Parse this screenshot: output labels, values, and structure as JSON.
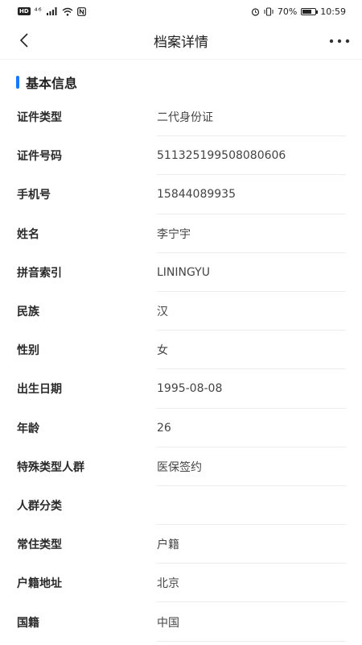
{
  "status_bar": {
    "left_chip": "HD",
    "network": "⁴⁶",
    "battery_percent": "70%",
    "battery_level": 0.7,
    "time": "10:59"
  },
  "nav": {
    "title": "档案详情",
    "back_icon": "chevron-left-icon",
    "more_icon": "more-horizontal-icon"
  },
  "section": {
    "title": "基本信息",
    "accent_color": "#1677ff"
  },
  "fields": [
    {
      "label": "证件类型",
      "value": "二代身份证"
    },
    {
      "label": "证件号码",
      "value": "511325199508080606"
    },
    {
      "label": "手机号",
      "value": "15844089935"
    },
    {
      "label": "姓名",
      "value": "李宁宇"
    },
    {
      "label": "拼音索引",
      "value": "LININGYU"
    },
    {
      "label": "民族",
      "value": "汉"
    },
    {
      "label": "性别",
      "value": "女"
    },
    {
      "label": "出生日期",
      "value": "1995-08-08"
    },
    {
      "label": "年龄",
      "value": "26"
    },
    {
      "label": "特殊类型人群",
      "value": "医保签约"
    },
    {
      "label": "人群分类",
      "value": ""
    },
    {
      "label": "常住类型",
      "value": "户籍"
    },
    {
      "label": "户籍地址",
      "value": "北京"
    },
    {
      "label": "国籍",
      "value": "中国"
    }
  ]
}
